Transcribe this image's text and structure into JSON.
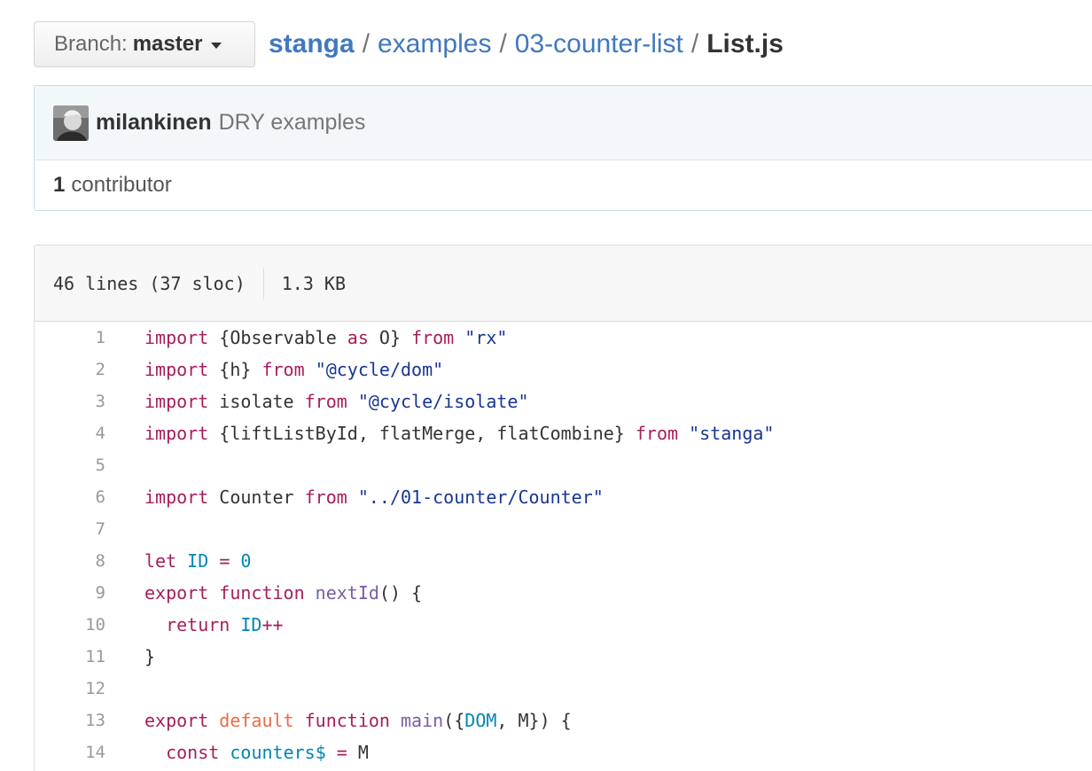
{
  "branch": {
    "label": "Branch:",
    "value": "master"
  },
  "breadcrumb": {
    "repo": "stanga",
    "sep": "/",
    "folder1": "examples",
    "folder2": "03-counter-list",
    "file": "List.js"
  },
  "commit": {
    "author": "milankinen",
    "message": "DRY examples",
    "contributors_count": "1",
    "contributors_label": "contributor"
  },
  "file_info": {
    "lines": "46 lines (37 sloc)",
    "size": "1.3 KB"
  },
  "code_lines": [
    {
      "n": "1",
      "tokens": [
        [
          "k",
          "import"
        ],
        [
          "p",
          " {Observable "
        ],
        [
          "k",
          "as"
        ],
        [
          "p",
          " O} "
        ],
        [
          "k",
          "from"
        ],
        [
          "p",
          " "
        ],
        [
          "s",
          "\"rx\""
        ]
      ]
    },
    {
      "n": "2",
      "tokens": [
        [
          "k",
          "import"
        ],
        [
          "p",
          " {h} "
        ],
        [
          "k",
          "from"
        ],
        [
          "p",
          " "
        ],
        [
          "s",
          "\"@cycle/dom\""
        ]
      ]
    },
    {
      "n": "3",
      "tokens": [
        [
          "k",
          "import"
        ],
        [
          "p",
          " isolate "
        ],
        [
          "k",
          "from"
        ],
        [
          "p",
          " "
        ],
        [
          "s",
          "\"@cycle/isolate\""
        ]
      ]
    },
    {
      "n": "4",
      "tokens": [
        [
          "k",
          "import"
        ],
        [
          "p",
          " {liftListById, flatMerge, flatCombine} "
        ],
        [
          "k",
          "from"
        ],
        [
          "p",
          " "
        ],
        [
          "s",
          "\"stanga\""
        ]
      ]
    },
    {
      "n": "5",
      "tokens": []
    },
    {
      "n": "6",
      "tokens": [
        [
          "k",
          "import"
        ],
        [
          "p",
          " Counter "
        ],
        [
          "k",
          "from"
        ],
        [
          "p",
          " "
        ],
        [
          "s",
          "\"../01-counter/Counter\""
        ]
      ]
    },
    {
      "n": "7",
      "tokens": []
    },
    {
      "n": "8",
      "tokens": [
        [
          "k",
          "let"
        ],
        [
          "p",
          " "
        ],
        [
          "c",
          "ID"
        ],
        [
          "p",
          " "
        ],
        [
          "k",
          "="
        ],
        [
          "p",
          " "
        ],
        [
          "c",
          "0"
        ]
      ]
    },
    {
      "n": "9",
      "tokens": [
        [
          "k",
          "export"
        ],
        [
          "p",
          " "
        ],
        [
          "k",
          "function"
        ],
        [
          "p",
          " "
        ],
        [
          "e",
          "nextId"
        ],
        [
          "p",
          "() {"
        ]
      ]
    },
    {
      "n": "10",
      "tokens": [
        [
          "p",
          "  "
        ],
        [
          "k",
          "return"
        ],
        [
          "p",
          " "
        ],
        [
          "c",
          "ID"
        ],
        [
          "k",
          "++"
        ]
      ]
    },
    {
      "n": "11",
      "tokens": [
        [
          "p",
          "}"
        ]
      ]
    },
    {
      "n": "12",
      "tokens": []
    },
    {
      "n": "13",
      "tokens": [
        [
          "k",
          "export"
        ],
        [
          "p",
          " "
        ],
        [
          "o",
          "default"
        ],
        [
          "p",
          " "
        ],
        [
          "k",
          "function"
        ],
        [
          "p",
          " "
        ],
        [
          "e",
          "main"
        ],
        [
          "p",
          "({"
        ],
        [
          "c",
          "DOM"
        ],
        [
          "p",
          ", M}) {"
        ]
      ]
    },
    {
      "n": "14",
      "tokens": [
        [
          "p",
          "  "
        ],
        [
          "k",
          "const"
        ],
        [
          "p",
          " "
        ],
        [
          "c",
          "counters$"
        ],
        [
          "p",
          " "
        ],
        [
          "k",
          "="
        ],
        [
          "p",
          " M"
        ]
      ]
    }
  ]
}
